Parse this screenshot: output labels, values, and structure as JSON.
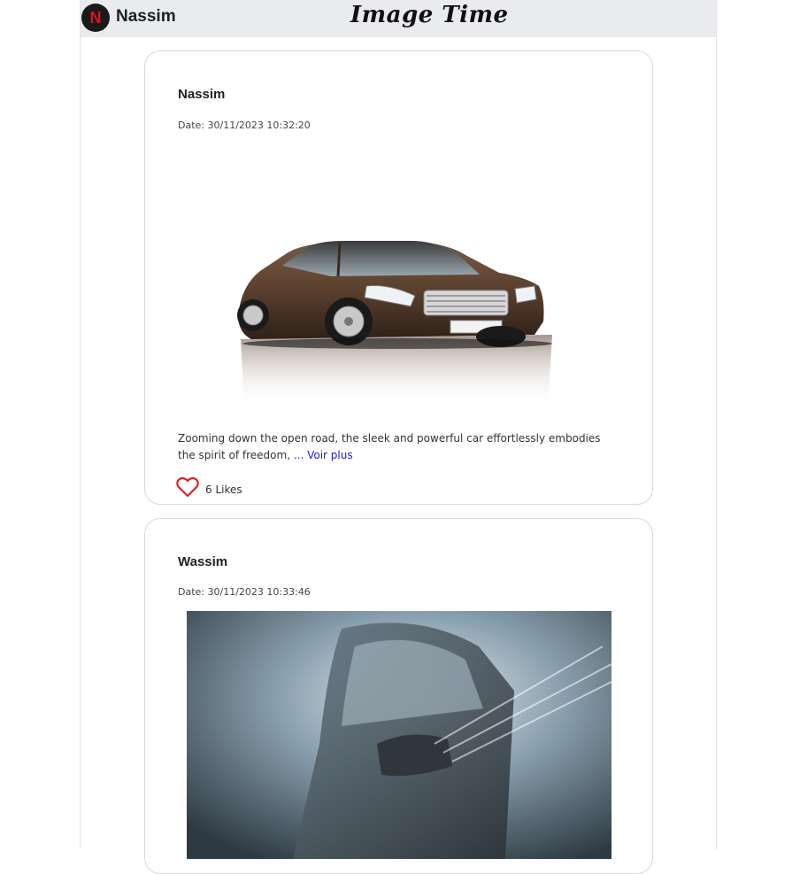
{
  "header": {
    "avatar_letter": "N",
    "username": "Nassim",
    "brand": "Image Time"
  },
  "posts": [
    {
      "author": "Nassim",
      "date": "Date: 30/11/2023 10:32:20",
      "image": "brown-sedan-photo",
      "description": "Zooming down the open road, the sleek and powerful car effortlessly embodies the spirit of freedom, ",
      "more_label": "... Voir plus",
      "likes": "6 Likes"
    },
    {
      "author": "Wassim",
      "date": "Date: 30/11/2023 10:33:46",
      "image": "car-wash-photo"
    }
  ],
  "colors": {
    "header_bg": "#e9ebee",
    "heart": "#e01f26",
    "link": "#1a1ae0",
    "avatar_letter": "#e0101e"
  }
}
